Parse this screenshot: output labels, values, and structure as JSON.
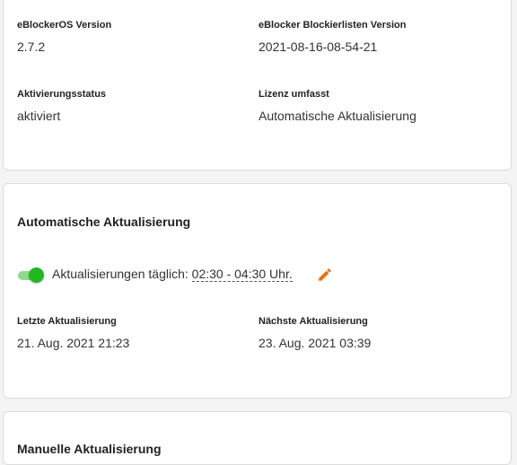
{
  "info": {
    "os_version_label": "eBlockerOS Version",
    "os_version_value": "2.7.2",
    "blocklist_version_label": "eBlocker Blockierlisten Version",
    "blocklist_version_value": "2021-08-16-08-54-21",
    "activation_label": "Aktivierungsstatus",
    "activation_value": "aktiviert",
    "license_label": "Lizenz umfasst",
    "license_value": "Automatische Aktualisierung"
  },
  "auto_update": {
    "title": "Automatische Aktualisierung",
    "enabled": true,
    "toggle_text": "Aktualisierungen täglich:",
    "time_range": "02:30 - 04:30 Uhr.",
    "edit_icon": "pencil-icon",
    "last_label": "Letzte Aktualisierung",
    "last_value": "21. Aug. 2021 21:23",
    "next_label": "Nächste Aktualisierung",
    "next_value": "23. Aug. 2021 03:39"
  },
  "manual_update": {
    "title": "Manuelle Aktualisierung"
  },
  "colors": {
    "toggle_on": "#1fb81f",
    "toggle_track": "#8fd98f",
    "edit_icon": "#e8700c"
  }
}
